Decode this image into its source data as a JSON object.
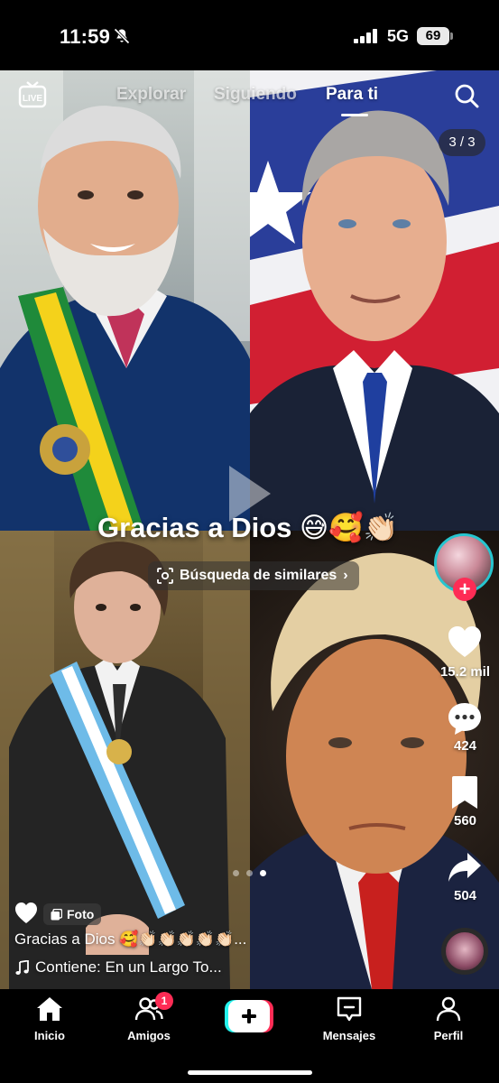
{
  "status_bar": {
    "time": "11:59",
    "network": "5G",
    "battery": "69",
    "icons": [
      "bell-slash-icon",
      "signal-icon"
    ]
  },
  "top_nav": {
    "live_icon": "live-icon",
    "tabs": [
      {
        "label": "Explorar",
        "active": false
      },
      {
        "label": "Siguiendo",
        "active": false
      },
      {
        "label": "Para ti",
        "active": true
      }
    ],
    "search_icon": "search-icon",
    "photo_counter": "3 / 3"
  },
  "post": {
    "overlay_caption": "Gracias a Dios 😅🥰👏🏻",
    "similar_search": "Búsqueda de similares",
    "badge": "Foto",
    "description": "Gracias a Dios 🥰👏🏻👏🏻👏🏻👏🏻👏🏻...",
    "music": "Contiene: En un Largo To...",
    "carousel": {
      "count": 3,
      "active": 3
    }
  },
  "actions": {
    "likes": "15.2 mil",
    "comments": "424",
    "saves": "560",
    "shares": "504"
  },
  "bottom_nav": {
    "items": [
      {
        "label": "Inicio",
        "icon": "home-icon"
      },
      {
        "label": "Amigos",
        "icon": "friends-icon",
        "badge": "1"
      },
      {
        "label": "",
        "icon": "create-plus-icon"
      },
      {
        "label": "Mensajes",
        "icon": "messages-icon"
      },
      {
        "label": "Perfil",
        "icon": "profile-icon"
      }
    ]
  },
  "colors": {
    "accent_red": "#fe2c55",
    "accent_cyan": "#25f4ee",
    "ring_cyan": "#27c5cf"
  }
}
